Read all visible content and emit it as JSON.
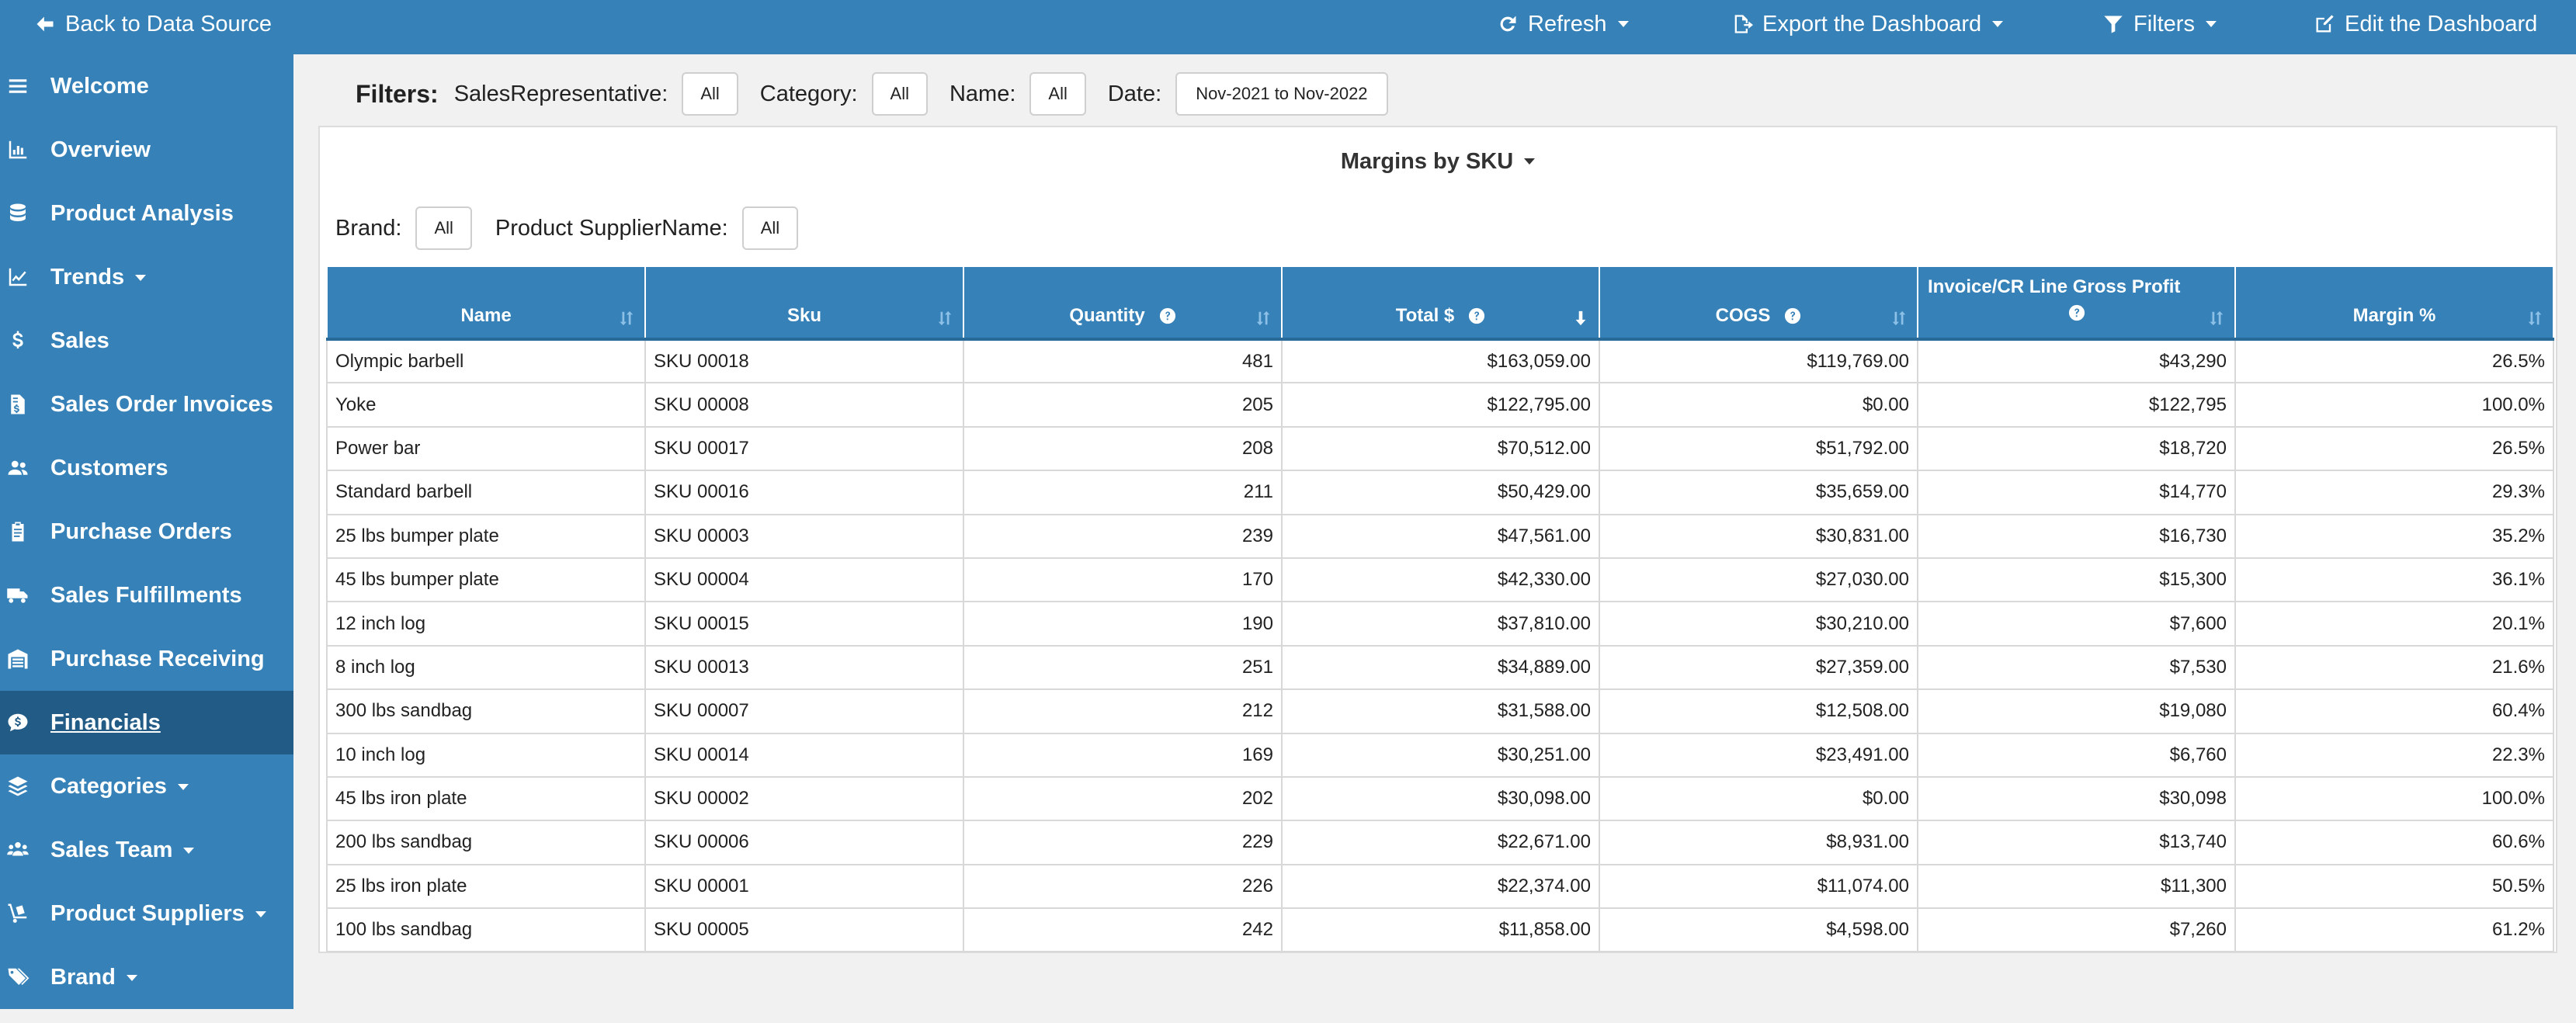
{
  "topbar": {
    "back_label": "Back to Data Source",
    "refresh_label": "Refresh",
    "export_label": "Export the Dashboard",
    "filters_label": "Filters",
    "edit_label": "Edit the Dashboard",
    "color": "#3581b8"
  },
  "sidebar": {
    "items": [
      {
        "label": "Welcome",
        "icon": "menu-icon"
      },
      {
        "label": "Overview",
        "icon": "chart-bar-icon"
      },
      {
        "label": "Product Analysis",
        "icon": "database-icon"
      },
      {
        "label": "Trends",
        "icon": "chart-line-icon"
      },
      {
        "label": "Sales",
        "icon": "dollar-icon"
      },
      {
        "label": "Sales Order Invoices",
        "icon": "invoice-icon"
      },
      {
        "label": "Customers",
        "icon": "users-icon"
      },
      {
        "label": "Purchase Orders",
        "icon": "clipboard-icon"
      },
      {
        "label": "Sales Fulfillments",
        "icon": "truck-icon"
      },
      {
        "label": "Purchase Receiving",
        "icon": "warehouse-icon"
      },
      {
        "label": "Financials",
        "icon": "money-chat-icon"
      },
      {
        "label": "Categories",
        "icon": "layers-icon"
      },
      {
        "label": "Sales Team",
        "icon": "team-icon"
      },
      {
        "label": "Product Suppliers",
        "icon": "dolly-icon"
      },
      {
        "label": "Brand",
        "icon": "tags-icon"
      }
    ],
    "active": "Financials",
    "active_color": "#215b86"
  },
  "filters": {
    "title": "Filters:",
    "sales_rep_label": "SalesRepresentative:",
    "sales_rep_value": "All",
    "category_label": "Category:",
    "category_value": "All",
    "name_label": "Name:",
    "name_value": "All",
    "date_label": "Date:",
    "date_value": "Nov-2021 to Nov-2022"
  },
  "panel": {
    "title": "Margins by SKU",
    "brand_label": "Brand:",
    "brand_value": "All",
    "supplier_label": "Product SupplierName:",
    "supplier_value": "All"
  },
  "table": {
    "headers": {
      "name": "Name",
      "sku": "Sku",
      "quantity": "Quantity",
      "total": "Total $",
      "cogs": "COGS",
      "gross_profit": "Invoice/CR Line Gross Profit",
      "margin": "Margin %"
    },
    "rows": [
      {
        "name": "Olympic barbell",
        "sku": "SKU 00018",
        "qty": "481",
        "total": "$163,059.00",
        "cogs": "$119,769.00",
        "gp": "$43,290",
        "margin": "26.5%"
      },
      {
        "name": "Yoke",
        "sku": "SKU 00008",
        "qty": "205",
        "total": "$122,795.00",
        "cogs": "$0.00",
        "gp": "$122,795",
        "margin": "100.0%"
      },
      {
        "name": "Power bar",
        "sku": "SKU 00017",
        "qty": "208",
        "total": "$70,512.00",
        "cogs": "$51,792.00",
        "gp": "$18,720",
        "margin": "26.5%"
      },
      {
        "name": "Standard barbell",
        "sku": "SKU 00016",
        "qty": "211",
        "total": "$50,429.00",
        "cogs": "$35,659.00",
        "gp": "$14,770",
        "margin": "29.3%"
      },
      {
        "name": "25 lbs bumper plate",
        "sku": "SKU 00003",
        "qty": "239",
        "total": "$47,561.00",
        "cogs": "$30,831.00",
        "gp": "$16,730",
        "margin": "35.2%"
      },
      {
        "name": "45 lbs bumper plate",
        "sku": "SKU 00004",
        "qty": "170",
        "total": "$42,330.00",
        "cogs": "$27,030.00",
        "gp": "$15,300",
        "margin": "36.1%"
      },
      {
        "name": "12 inch log",
        "sku": "SKU 00015",
        "qty": "190",
        "total": "$37,810.00",
        "cogs": "$30,210.00",
        "gp": "$7,600",
        "margin": "20.1%"
      },
      {
        "name": "8 inch log",
        "sku": "SKU 00013",
        "qty": "251",
        "total": "$34,889.00",
        "cogs": "$27,359.00",
        "gp": "$7,530",
        "margin": "21.6%"
      },
      {
        "name": "300 lbs sandbag",
        "sku": "SKU 00007",
        "qty": "212",
        "total": "$31,588.00",
        "cogs": "$12,508.00",
        "gp": "$19,080",
        "margin": "60.4%"
      },
      {
        "name": "10 inch log",
        "sku": "SKU 00014",
        "qty": "169",
        "total": "$30,251.00",
        "cogs": "$23,491.00",
        "gp": "$6,760",
        "margin": "22.3%"
      },
      {
        "name": "45 lbs iron plate",
        "sku": "SKU 00002",
        "qty": "202",
        "total": "$30,098.00",
        "cogs": "$0.00",
        "gp": "$30,098",
        "margin": "100.0%"
      },
      {
        "name": "200 lbs sandbag",
        "sku": "SKU 00006",
        "qty": "229",
        "total": "$22,671.00",
        "cogs": "$8,931.00",
        "gp": "$13,740",
        "margin": "60.6%"
      },
      {
        "name": "25 lbs iron plate",
        "sku": "SKU 00001",
        "qty": "226",
        "total": "$22,374.00",
        "cogs": "$11,074.00",
        "gp": "$11,300",
        "margin": "50.5%"
      },
      {
        "name": "100 lbs sandbag",
        "sku": "SKU 00005",
        "qty": "242",
        "total": "$11,858.00",
        "cogs": "$4,598.00",
        "gp": "$7,260",
        "margin": "61.2%"
      }
    ]
  }
}
